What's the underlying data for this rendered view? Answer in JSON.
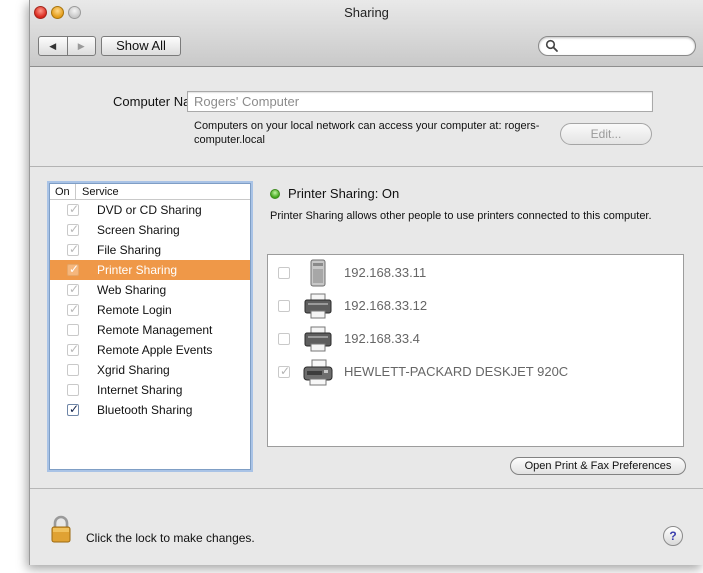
{
  "window": {
    "title": "Sharing"
  },
  "toolbar": {
    "back_glyph": "◀",
    "forward_glyph": "▶",
    "show_all_label": "Show All",
    "search_value": ""
  },
  "computer_name": {
    "label": "Computer Name:",
    "value": "Rogers' Computer",
    "address_text": "Computers on your local network can access your computer at: rogers-computer.local",
    "edit_label": "Edit..."
  },
  "service_list": {
    "header_on": "On",
    "header_service": "Service",
    "items": [
      {
        "label": "DVD or CD Sharing",
        "checked": true,
        "selected": false,
        "active": false
      },
      {
        "label": "Screen Sharing",
        "checked": true,
        "selected": false,
        "active": false
      },
      {
        "label": "File Sharing",
        "checked": true,
        "selected": false,
        "active": false
      },
      {
        "label": "Printer Sharing",
        "checked": true,
        "selected": true,
        "active": false
      },
      {
        "label": "Web Sharing",
        "checked": true,
        "selected": false,
        "active": false
      },
      {
        "label": "Remote Login",
        "checked": true,
        "selected": false,
        "active": false
      },
      {
        "label": "Remote Management",
        "checked": false,
        "selected": false,
        "active": false
      },
      {
        "label": "Remote Apple Events",
        "checked": true,
        "selected": false,
        "active": false
      },
      {
        "label": "Xgrid Sharing",
        "checked": false,
        "selected": false,
        "active": false
      },
      {
        "label": "Internet Sharing",
        "checked": false,
        "selected": false,
        "active": false
      },
      {
        "label": "Bluetooth Sharing",
        "checked": true,
        "selected": false,
        "active": true
      }
    ]
  },
  "detail": {
    "status_title": "Printer Sharing: On",
    "status_color": "#3fa51a",
    "description": "Printer Sharing allows other people to use printers connected to this computer.",
    "printers": [
      {
        "label": "192.168.33.11",
        "checked": false,
        "icon": "laser-printer-icon"
      },
      {
        "label": "192.168.33.12",
        "checked": false,
        "icon": "printer-icon"
      },
      {
        "label": "192.168.33.4",
        "checked": false,
        "icon": "printer-icon"
      },
      {
        "label": "HEWLETT-PACKARD DESKJET 920C",
        "checked": true,
        "icon": "inkjet-printer-icon"
      }
    ],
    "open_prefs_label": "Open Print & Fax Preferences"
  },
  "bottom": {
    "lock_text": "Click the lock to make changes.",
    "help_glyph": "?"
  },
  "colors": {
    "selection": "#ef9848",
    "list_focus_ring": "#a9c3e6",
    "help_glyph": "#3b3fae"
  }
}
